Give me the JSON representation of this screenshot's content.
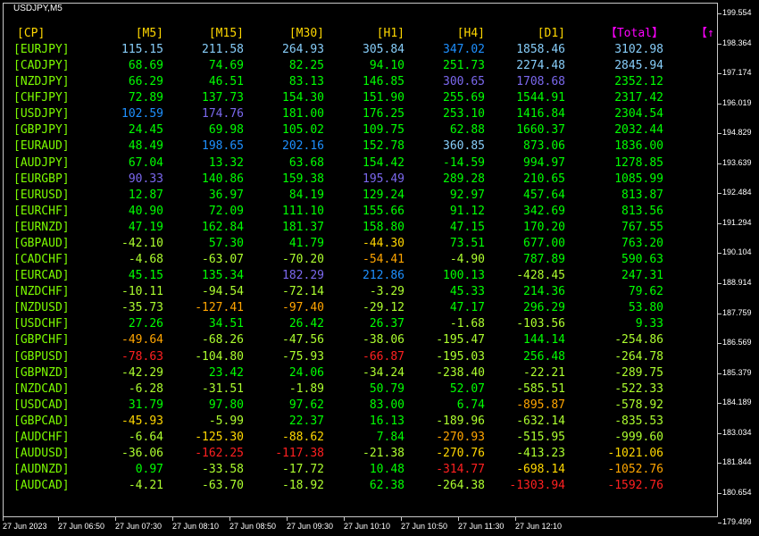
{
  "window_title": "USDJPY,M5",
  "colors": {
    "pair": "#7CFC00",
    "header": "#FFD700",
    "total_header": "#FF00FF",
    "bright_positive": "#1E90FF",
    "light_blue": "#87CEFA",
    "slate_blue": "#7B68EE",
    "positive": "#00FF00",
    "mild_positive": "#7CFC00",
    "yellow": "#FFD700",
    "orange": "#FFA500",
    "red": "#FF2020",
    "mild_negative": "#ADFF2F"
  },
  "table": {
    "headers": [
      "[CP]",
      "[M5]",
      "[M15]",
      "[M30]",
      "[H1]",
      "[H4]",
      "[D1]",
      "【Total】",
      "【↑"
    ],
    "rows": [
      {
        "pair": "[EURJPY]",
        "values": [
          "115.15",
          "211.58",
          "264.93",
          "305.84",
          "347.02",
          "1858.46",
          "3102.98"
        ],
        "colors": [
          "light_blue",
          "light_blue",
          "light_blue",
          "light_blue",
          "bright_positive",
          "light_blue",
          "light_blue"
        ]
      },
      {
        "pair": "[CADJPY]",
        "values": [
          "68.69",
          "74.69",
          "82.25",
          "94.10",
          "251.73",
          "2274.48",
          "2845.94"
        ],
        "colors": [
          "positive",
          "positive",
          "positive",
          "positive",
          "positive",
          "light_blue",
          "light_blue"
        ]
      },
      {
        "pair": "[NZDJPY]",
        "values": [
          "66.29",
          "46.51",
          "83.13",
          "146.85",
          "300.65",
          "1708.68",
          "2352.12"
        ],
        "colors": [
          "positive",
          "positive",
          "positive",
          "positive",
          "slate_blue",
          "slate_blue",
          "positive"
        ]
      },
      {
        "pair": "[CHFJPY]",
        "values": [
          "72.89",
          "137.73",
          "154.30",
          "151.90",
          "255.69",
          "1544.91",
          "2317.42"
        ],
        "colors": [
          "positive",
          "positive",
          "positive",
          "positive",
          "positive",
          "positive",
          "positive"
        ]
      },
      {
        "pair": "[USDJPY]",
        "values": [
          "102.59",
          "174.76",
          "181.00",
          "176.25",
          "253.10",
          "1416.84",
          "2304.54"
        ],
        "colors": [
          "bright_positive",
          "slate_blue",
          "positive",
          "positive",
          "positive",
          "positive",
          "positive"
        ]
      },
      {
        "pair": "[GBPJPY]",
        "values": [
          "24.45",
          "69.98",
          "105.02",
          "109.75",
          "62.88",
          "1660.37",
          "2032.44"
        ],
        "colors": [
          "positive",
          "positive",
          "positive",
          "positive",
          "positive",
          "positive",
          "positive"
        ]
      },
      {
        "pair": "[EURAUD]",
        "values": [
          "48.49",
          "198.65",
          "202.16",
          "152.78",
          "360.85",
          "873.06",
          "1836.00"
        ],
        "colors": [
          "positive",
          "bright_positive",
          "bright_positive",
          "positive",
          "light_blue",
          "positive",
          "positive"
        ]
      },
      {
        "pair": "[AUDJPY]",
        "values": [
          "67.04",
          "13.32",
          "63.68",
          "154.42",
          "-14.59",
          "994.97",
          "1278.85"
        ],
        "colors": [
          "positive",
          "positive",
          "positive",
          "positive",
          "positive",
          "positive",
          "positive"
        ]
      },
      {
        "pair": "[EURGBP]",
        "values": [
          "90.33",
          "140.86",
          "159.38",
          "195.49",
          "289.28",
          "210.65",
          "1085.99"
        ],
        "colors": [
          "slate_blue",
          "positive",
          "positive",
          "slate_blue",
          "positive",
          "positive",
          "positive"
        ]
      },
      {
        "pair": "[EURUSD]",
        "values": [
          "12.87",
          "36.97",
          "84.19",
          "129.24",
          "92.97",
          "457.64",
          "813.87"
        ],
        "colors": [
          "positive",
          "positive",
          "positive",
          "positive",
          "positive",
          "positive",
          "positive"
        ]
      },
      {
        "pair": "[EURCHF]",
        "values": [
          "40.90",
          "72.09",
          "111.10",
          "155.66",
          "91.12",
          "342.69",
          "813.56"
        ],
        "colors": [
          "positive",
          "positive",
          "positive",
          "positive",
          "positive",
          "positive",
          "positive"
        ]
      },
      {
        "pair": "[EURNZD]",
        "values": [
          "47.19",
          "162.84",
          "181.37",
          "158.80",
          "47.15",
          "170.20",
          "767.55"
        ],
        "colors": [
          "positive",
          "positive",
          "positive",
          "positive",
          "positive",
          "positive",
          "positive"
        ]
      },
      {
        "pair": "[GBPAUD]",
        "values": [
          "-42.10",
          "57.30",
          "41.79",
          "-44.30",
          "73.51",
          "677.00",
          "763.20"
        ],
        "colors": [
          "mild_negative",
          "positive",
          "positive",
          "yellow",
          "positive",
          "positive",
          "positive"
        ]
      },
      {
        "pair": "[CADCHF]",
        "values": [
          "-4.68",
          "-63.07",
          "-70.20",
          "-54.41",
          "-4.90",
          "787.89",
          "590.63"
        ],
        "colors": [
          "mild_negative",
          "mild_negative",
          "mild_negative",
          "orange",
          "mild_negative",
          "positive",
          "positive"
        ]
      },
      {
        "pair": "[EURCAD]",
        "values": [
          "45.15",
          "135.34",
          "182.29",
          "212.86",
          "100.13",
          "-428.45",
          "247.31"
        ],
        "colors": [
          "positive",
          "positive",
          "slate_blue",
          "bright_positive",
          "positive",
          "mild_negative",
          "positive"
        ]
      },
      {
        "pair": "[NZDCHF]",
        "values": [
          "-10.11",
          "-94.54",
          "-72.14",
          "-3.29",
          "45.33",
          "214.36",
          "79.62"
        ],
        "colors": [
          "mild_negative",
          "mild_negative",
          "mild_negative",
          "mild_negative",
          "positive",
          "positive",
          "positive"
        ]
      },
      {
        "pair": "[NZDUSD]",
        "values": [
          "-35.73",
          "-127.41",
          "-97.40",
          "-29.12",
          "47.17",
          "296.29",
          "53.80"
        ],
        "colors": [
          "mild_negative",
          "orange",
          "orange",
          "mild_negative",
          "positive",
          "positive",
          "positive"
        ]
      },
      {
        "pair": "[USDCHF]",
        "values": [
          "27.26",
          "34.51",
          "26.42",
          "26.37",
          "-1.68",
          "-103.56",
          "9.33"
        ],
        "colors": [
          "positive",
          "positive",
          "positive",
          "positive",
          "mild_negative",
          "mild_negative",
          "positive"
        ]
      },
      {
        "pair": "[GBPCHF]",
        "values": [
          "-49.64",
          "-68.26",
          "-47.56",
          "-38.06",
          "-195.47",
          "144.14",
          "-254.86"
        ],
        "colors": [
          "orange",
          "mild_negative",
          "mild_negative",
          "mild_negative",
          "mild_negative",
          "positive",
          "mild_negative"
        ]
      },
      {
        "pair": "[GBPUSD]",
        "values": [
          "-78.63",
          "-104.80",
          "-75.93",
          "-66.87",
          "-195.03",
          "256.48",
          "-264.78"
        ],
        "colors": [
          "red",
          "mild_negative",
          "mild_negative",
          "red",
          "mild_negative",
          "positive",
          "mild_negative"
        ]
      },
      {
        "pair": "[GBPNZD]",
        "values": [
          "-42.29",
          "23.42",
          "24.06",
          "-34.24",
          "-238.40",
          "-22.21",
          "-289.75"
        ],
        "colors": [
          "mild_negative",
          "positive",
          "positive",
          "mild_negative",
          "mild_negative",
          "mild_negative",
          "mild_negative"
        ]
      },
      {
        "pair": "[NZDCAD]",
        "values": [
          "-6.28",
          "-31.51",
          "-1.89",
          "50.79",
          "52.07",
          "-585.51",
          "-522.33"
        ],
        "colors": [
          "mild_negative",
          "mild_negative",
          "mild_negative",
          "positive",
          "positive",
          "mild_negative",
          "mild_negative"
        ]
      },
      {
        "pair": "[USDCAD]",
        "values": [
          "31.79",
          "97.80",
          "97.62",
          "83.00",
          "6.74",
          "-895.87",
          "-578.92"
        ],
        "colors": [
          "positive",
          "positive",
          "positive",
          "positive",
          "positive",
          "orange",
          "mild_negative"
        ]
      },
      {
        "pair": "[GBPCAD]",
        "values": [
          "-45.93",
          "-5.99",
          "22.37",
          "16.13",
          "-189.96",
          "-632.14",
          "-835.53"
        ],
        "colors": [
          "yellow",
          "mild_negative",
          "positive",
          "positive",
          "mild_negative",
          "mild_negative",
          "mild_negative"
        ]
      },
      {
        "pair": "[AUDCHF]",
        "values": [
          "-6.64",
          "-125.30",
          "-88.62",
          "7.84",
          "-270.93",
          "-515.95",
          "-999.60"
        ],
        "colors": [
          "mild_negative",
          "yellow",
          "yellow",
          "positive",
          "orange",
          "mild_negative",
          "mild_negative"
        ]
      },
      {
        "pair": "[AUDUSD]",
        "values": [
          "-36.06",
          "-162.25",
          "-117.38",
          "-21.38",
          "-270.76",
          "-413.23",
          "-1021.06"
        ],
        "colors": [
          "mild_negative",
          "red",
          "red",
          "mild_negative",
          "yellow",
          "mild_negative",
          "yellow"
        ]
      },
      {
        "pair": "[AUDNZD]",
        "values": [
          "0.97",
          "-33.58",
          "-17.72",
          "10.48",
          "-314.77",
          "-698.14",
          "-1052.76"
        ],
        "colors": [
          "positive",
          "mild_negative",
          "mild_negative",
          "positive",
          "red",
          "yellow",
          "orange"
        ]
      },
      {
        "pair": "[AUDCAD]",
        "values": [
          "-4.21",
          "-63.70",
          "-18.92",
          "62.38",
          "-264.38",
          "-1303.94",
          "-1592.76"
        ],
        "colors": [
          "mild_negative",
          "mild_negative",
          "mild_negative",
          "positive",
          "mild_negative",
          "red",
          "red"
        ]
      }
    ]
  },
  "price_axis": [
    "199.554",
    "198.364",
    "197.174",
    "196.019",
    "194.829",
    "193.639",
    "192.484",
    "191.294",
    "190.104",
    "188.914",
    "187.759",
    "186.569",
    "185.379",
    "184.189",
    "183.034",
    "181.844",
    "180.654",
    "179.499"
  ],
  "time_axis": [
    "27 Jun 2023",
    "27 Jun 06:50",
    "27 Jun 07:30",
    "27 Jun 08:10",
    "27 Jun 08:50",
    "27 Jun 09:30",
    "27 Jun 10:10",
    "27 Jun 10:50",
    "27 Jun 11:30",
    "27 Jun 12:10"
  ]
}
